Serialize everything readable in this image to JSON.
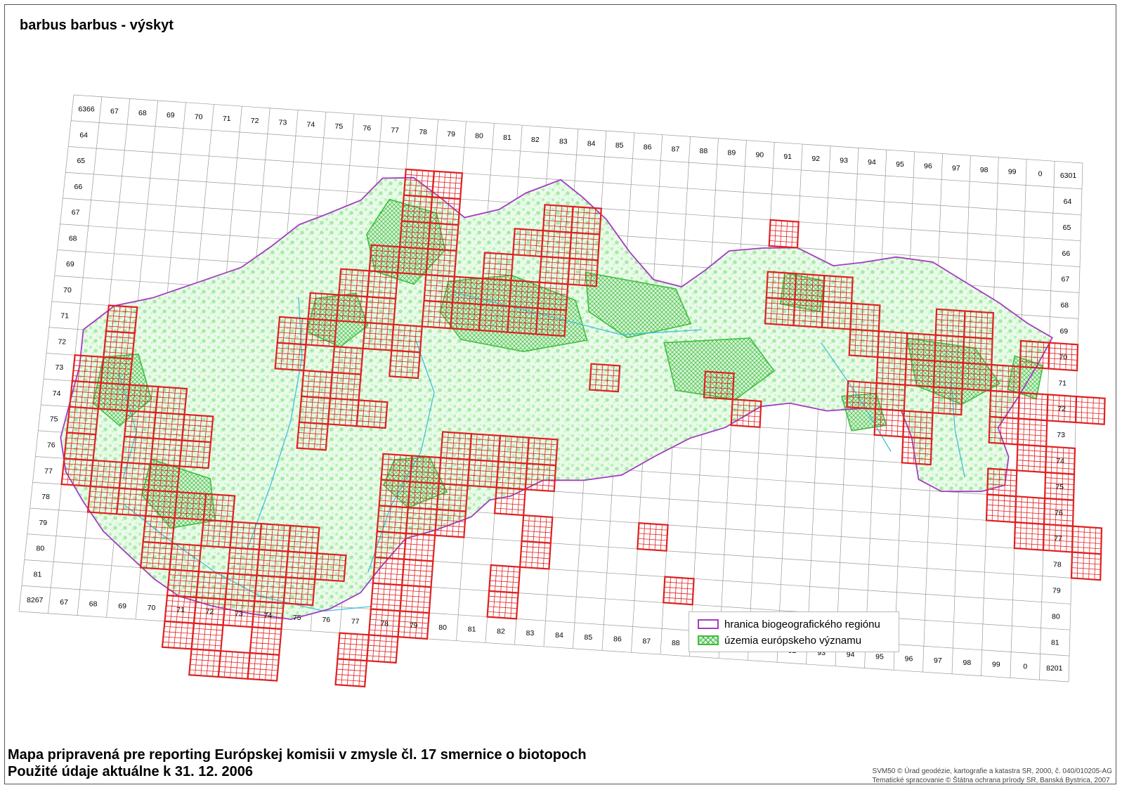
{
  "map": {
    "title": "barbus barbus - výskyt",
    "footer_line1": "Mapa pripravená pre reporting Európskej komisii v zmysle čl. 17 smernice o biotopoch",
    "footer_line2": "Použité údaje aktuálne k 31. 12. 2006",
    "credit_line1": "SVM50 © Úrad geodézie, kartografie a katastra SR, 2000, č. 040/010205-AG",
    "credit_line2": "Tematické spracovanie © Štátna ochrana prírody SR, Banská Bystrica, 2007"
  },
  "legend": {
    "border_label": "hranica biogeografického regiónu",
    "natura_label": "územia európskeho významu"
  },
  "colors": {
    "grid": "#9a9a9a",
    "occurrence": "#e02020",
    "region_border": "#a43cc2",
    "natura_fill": "#d6f5d6",
    "natura_edge": "#3cc03c",
    "rivers": "#40c0e0"
  },
  "grid": {
    "top_labels": [
      "6366",
      "67",
      "68",
      "69",
      "70",
      "71",
      "72",
      "73",
      "74",
      "75",
      "76",
      "77",
      "78",
      "79",
      "80",
      "81",
      "82",
      "83",
      "84",
      "85",
      "86",
      "87",
      "88",
      "89",
      "90",
      "91",
      "92",
      "93",
      "94",
      "95",
      "96",
      "97",
      "98",
      "99",
      "0"
    ],
    "top_right_corner": "6301",
    "bottom_labels": [
      "8267",
      "67",
      "68",
      "69",
      "70",
      "71",
      "72",
      "73",
      "74",
      "75",
      "76",
      "77",
      "78",
      "79",
      "80",
      "81",
      "82",
      "83",
      "84",
      "85",
      "86",
      "87",
      "88",
      "89",
      "90",
      "91",
      "92",
      "93",
      "94",
      "95",
      "96",
      "97",
      "98",
      "99",
      "0"
    ],
    "bottom_right_corner": "8201",
    "left_labels": [
      "64",
      "65",
      "66",
      "67",
      "68",
      "69",
      "70",
      "71",
      "72",
      "73",
      "74",
      "75",
      "76",
      "77",
      "78",
      "79",
      "80",
      "81"
    ],
    "right_labels": [
      "64",
      "65",
      "66",
      "67",
      "68",
      "69",
      "70",
      "71",
      "72",
      "73",
      "74",
      "75",
      "76",
      "77",
      "78",
      "79",
      "80",
      "81"
    ]
  },
  "occurrence_cells": [
    [
      11,
      1
    ],
    [
      11,
      2
    ],
    [
      11,
      3
    ],
    [
      11,
      4
    ],
    [
      12,
      1
    ],
    [
      12,
      2
    ],
    [
      12,
      3
    ],
    [
      12,
      4
    ],
    [
      10,
      4
    ],
    [
      10,
      5
    ],
    [
      9,
      5
    ],
    [
      9,
      6
    ],
    [
      8,
      6
    ],
    [
      8,
      7
    ],
    [
      7,
      7
    ],
    [
      7,
      8
    ],
    [
      10,
      6
    ],
    [
      10,
      7
    ],
    [
      11,
      7
    ],
    [
      11,
      8
    ],
    [
      9,
      8
    ],
    [
      9,
      9
    ],
    [
      8,
      9
    ],
    [
      8,
      10
    ],
    [
      8,
      11
    ],
    [
      9,
      10
    ],
    [
      10,
      10
    ],
    [
      1,
      7
    ],
    [
      1,
      8
    ],
    [
      1,
      9
    ],
    [
      1,
      10
    ],
    [
      0,
      9
    ],
    [
      0,
      10
    ],
    [
      0,
      11
    ],
    [
      0,
      12
    ],
    [
      0,
      13
    ],
    [
      2,
      10
    ],
    [
      2,
      11
    ],
    [
      2,
      12
    ],
    [
      2,
      13
    ],
    [
      3,
      10
    ],
    [
      3,
      11
    ],
    [
      3,
      12
    ],
    [
      3,
      13
    ],
    [
      4,
      11
    ],
    [
      4,
      12
    ],
    [
      1,
      13
    ],
    [
      1,
      14
    ],
    [
      2,
      14
    ],
    [
      3,
      14
    ],
    [
      4,
      14
    ],
    [
      5,
      14
    ],
    [
      5,
      15
    ],
    [
      6,
      15
    ],
    [
      6,
      16
    ],
    [
      7,
      16
    ],
    [
      7,
      15
    ],
    [
      8,
      15
    ],
    [
      8,
      16
    ],
    [
      9,
      16
    ],
    [
      3,
      15
    ],
    [
      3,
      16
    ],
    [
      4,
      16
    ],
    [
      4,
      17
    ],
    [
      5,
      17
    ],
    [
      5,
      18
    ],
    [
      6,
      17
    ],
    [
      6,
      18
    ],
    [
      7,
      17
    ],
    [
      7,
      18
    ],
    [
      8,
      17
    ],
    [
      4,
      18
    ],
    [
      4,
      19
    ],
    [
      5,
      19
    ],
    [
      5,
      20
    ],
    [
      6,
      20
    ],
    [
      7,
      20
    ],
    [
      7,
      19
    ],
    [
      11,
      12
    ],
    [
      11,
      13
    ],
    [
      12,
      12
    ],
    [
      12,
      13
    ],
    [
      13,
      12
    ],
    [
      13,
      13
    ],
    [
      13,
      14
    ],
    [
      12,
      14
    ],
    [
      11,
      14
    ],
    [
      11,
      15
    ],
    [
      12,
      15
    ],
    [
      12,
      16
    ],
    [
      11,
      16
    ],
    [
      11,
      17
    ],
    [
      14,
      11
    ],
    [
      14,
      12
    ],
    [
      15,
      11
    ],
    [
      15,
      12
    ],
    [
      16,
      11
    ],
    [
      16,
      12
    ],
    [
      13,
      11
    ],
    [
      12,
      18
    ],
    [
      12,
      17
    ],
    [
      11,
      18
    ],
    [
      11,
      19
    ],
    [
      10,
      19
    ],
    [
      10,
      20
    ],
    [
      15,
      13
    ],
    [
      15,
      16
    ],
    [
      15,
      17
    ],
    [
      16,
      14
    ],
    [
      16,
      15
    ],
    [
      14,
      4
    ],
    [
      14,
      5
    ],
    [
      13,
      5
    ],
    [
      13,
      6
    ],
    [
      12,
      6
    ],
    [
      12,
      5
    ],
    [
      14,
      6
    ],
    [
      15,
      6
    ],
    [
      16,
      6
    ],
    [
      16,
      5
    ],
    [
      15,
      5
    ],
    [
      15,
      3
    ],
    [
      16,
      3
    ],
    [
      16,
      4
    ],
    [
      17,
      3
    ],
    [
      17,
      4
    ],
    [
      18,
      8
    ],
    [
      22,
      8
    ],
    [
      23,
      9
    ],
    [
      20,
      14
    ],
    [
      21,
      16
    ],
    [
      17,
      2
    ],
    [
      16,
      2
    ],
    [
      24,
      2
    ],
    [
      24,
      4
    ],
    [
      25,
      4
    ],
    [
      24,
      5
    ],
    [
      25,
      5
    ],
    [
      26,
      5
    ],
    [
      26,
      4
    ],
    [
      27,
      6
    ],
    [
      27,
      5
    ],
    [
      28,
      6
    ],
    [
      28,
      7
    ],
    [
      29,
      6
    ],
    [
      29,
      7
    ],
    [
      27,
      8
    ],
    [
      28,
      8
    ],
    [
      28,
      9
    ],
    [
      29,
      9
    ],
    [
      29,
      10
    ],
    [
      30,
      6
    ],
    [
      31,
      6
    ],
    [
      30,
      5
    ],
    [
      31,
      5
    ],
    [
      31,
      7
    ],
    [
      32,
      7
    ],
    [
      32,
      8
    ],
    [
      33,
      8
    ],
    [
      33,
      9
    ],
    [
      32,
      9
    ],
    [
      30,
      7
    ],
    [
      30,
      8
    ],
    [
      33,
      6
    ],
    [
      34,
      6
    ],
    [
      34,
      8
    ],
    [
      35,
      8
    ],
    [
      33,
      10
    ],
    [
      34,
      10
    ],
    [
      34,
      11
    ],
    [
      32,
      11
    ],
    [
      32,
      12
    ],
    [
      33,
      12
    ],
    [
      33,
      13
    ],
    [
      34,
      12
    ],
    [
      34,
      13
    ],
    [
      35,
      13
    ],
    [
      35,
      14
    ]
  ]
}
